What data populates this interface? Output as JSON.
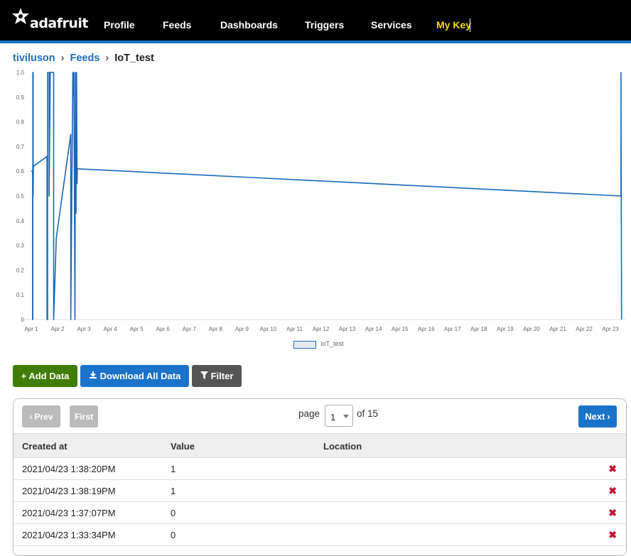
{
  "nav": {
    "logo": "adafruit",
    "items": [
      {
        "label": "Profile"
      },
      {
        "label": "Feeds"
      },
      {
        "label": "Dashboards"
      },
      {
        "label": "Triggers"
      },
      {
        "label": "Services"
      },
      {
        "label": "My Key"
      }
    ]
  },
  "breadcrumb": {
    "user": "tiviluson",
    "feeds": "Feeds",
    "current": "IoT_test"
  },
  "chart_data": {
    "type": "line",
    "series": [
      {
        "name": "IoT_test",
        "color": "#1a66b8"
      }
    ],
    "x_labels": [
      "Apr 1",
      "Apr 2",
      "Apr 3",
      "Apr 4",
      "Apr 5",
      "Apr 6",
      "Apr 7",
      "Apr 8",
      "Apr 9",
      "Apr 10",
      "Apr 11",
      "Apr 12",
      "Apr 13",
      "Apr 14",
      "Apr 15",
      "Apr 16",
      "Apr 17",
      "Apr 18",
      "Apr 19",
      "Apr 20",
      "Apr 21",
      "Apr 22",
      "Apr 23"
    ],
    "y_labels": [
      "0",
      "0.1",
      "0.2",
      "0.3",
      "0.4",
      "0.5",
      "0.6",
      "0.7",
      "0.8",
      "0.9",
      "1.0"
    ],
    "ylim": [
      0,
      1
    ],
    "points": [
      [
        0.0,
        0.6
      ],
      [
        0.05,
        0.6
      ],
      [
        0.05,
        0
      ],
      [
        0.06,
        0
      ],
      [
        0.06,
        1
      ],
      [
        0.07,
        1
      ],
      [
        0.07,
        0.5
      ],
      [
        0.08,
        0.62
      ],
      [
        0.6,
        0.66
      ],
      [
        0.6,
        0
      ],
      [
        0.62,
        0
      ],
      [
        0.62,
        1
      ],
      [
        0.68,
        1
      ],
      [
        0.68,
        0.5
      ],
      [
        0.72,
        1
      ],
      [
        0.85,
        1
      ],
      [
        0.85,
        0
      ],
      [
        0.95,
        0.33
      ],
      [
        1.5,
        0.75
      ],
      [
        1.5,
        0
      ],
      [
        1.58,
        1
      ],
      [
        1.62,
        0.9
      ],
      [
        1.62,
        1
      ],
      [
        1.66,
        0
      ],
      [
        1.68,
        1
      ],
      [
        1.7,
        0.43
      ],
      [
        1.72,
        1
      ],
      [
        1.74,
        0.55
      ],
      [
        1.75,
        0.61
      ],
      [
        22.4,
        0.5
      ],
      [
        22.4,
        1
      ],
      [
        22.42,
        0
      ]
    ],
    "legend": "bottom",
    "grid": false
  },
  "actions": {
    "add": "+ Add Data",
    "download": "Download All Data",
    "filter": "Filter"
  },
  "pager": {
    "prev": "Prev",
    "first": "First",
    "page_label": "page",
    "page_value": "1",
    "of": "of 15",
    "next": "Next"
  },
  "table": {
    "headers": [
      "Created at",
      "Value",
      "Location"
    ],
    "rows": [
      {
        "created": "2021/04/23 1:38:20PM",
        "value": "1",
        "location": ""
      },
      {
        "created": "2021/04/23 1:38:19PM",
        "value": "1",
        "location": ""
      },
      {
        "created": "2021/04/23 1:37:07PM",
        "value": "0",
        "location": ""
      },
      {
        "created": "2021/04/23 1:33:34PM",
        "value": "0",
        "location": ""
      }
    ]
  }
}
